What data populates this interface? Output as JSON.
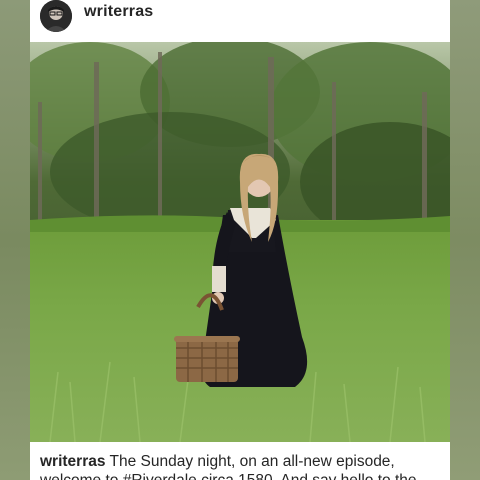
{
  "post": {
    "username": "writerras",
    "avatar_icon": "profile-photo-avatar",
    "caption_user": "writerras",
    "caption_text": "The Sunday night, on an all-new episode, welcome to #Riverdale circa 1580. And say hello to the..."
  },
  "colors": {
    "text": "#262626",
    "background": "#ffffff",
    "grass": "#6f9a3a",
    "dress": "#15151c"
  }
}
